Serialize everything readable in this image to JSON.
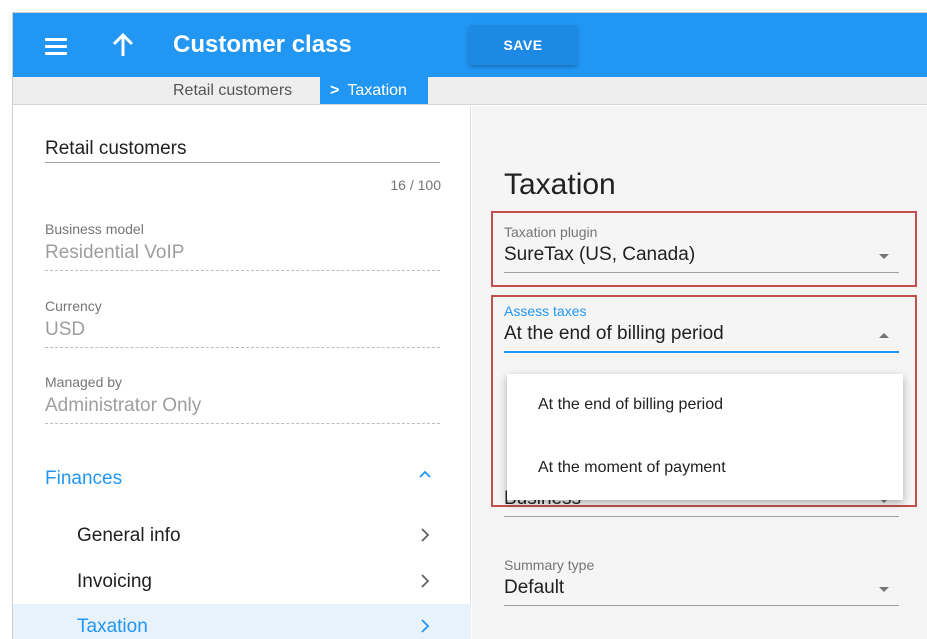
{
  "header": {
    "title": "Customer class",
    "save_label": "SAVE",
    "menu_icon": "hamburger-menu-icon",
    "up_icon": "arrow-up-icon"
  },
  "breadcrumb": {
    "parent": "Retail customers",
    "current": "Taxation",
    "separator": ">"
  },
  "left": {
    "name": "Retail customers",
    "counter": "16 / 100",
    "business_model": {
      "label": "Business model",
      "value": "Residential VoIP"
    },
    "currency": {
      "label": "Currency",
      "value": "USD"
    },
    "managed_by": {
      "label": "Managed by",
      "value": "Administrator Only"
    },
    "section": "Finances",
    "nav": [
      {
        "label": "General info"
      },
      {
        "label": "Invoicing"
      },
      {
        "label": "Taxation"
      }
    ]
  },
  "right": {
    "title": "Taxation",
    "taxation_plugin": {
      "label": "Taxation plugin",
      "value": "SureTax (US, Canada)"
    },
    "assess_taxes": {
      "label": "Assess taxes",
      "value": "At the end of billing period",
      "options": [
        "At the end of billing period",
        "At the moment of payment"
      ]
    },
    "customer_type": {
      "value": "Business"
    },
    "summary_type": {
      "label": "Summary type",
      "value": "Default"
    }
  },
  "colors": {
    "primary": "#2196f3",
    "highlight_border": "#c0504d"
  }
}
